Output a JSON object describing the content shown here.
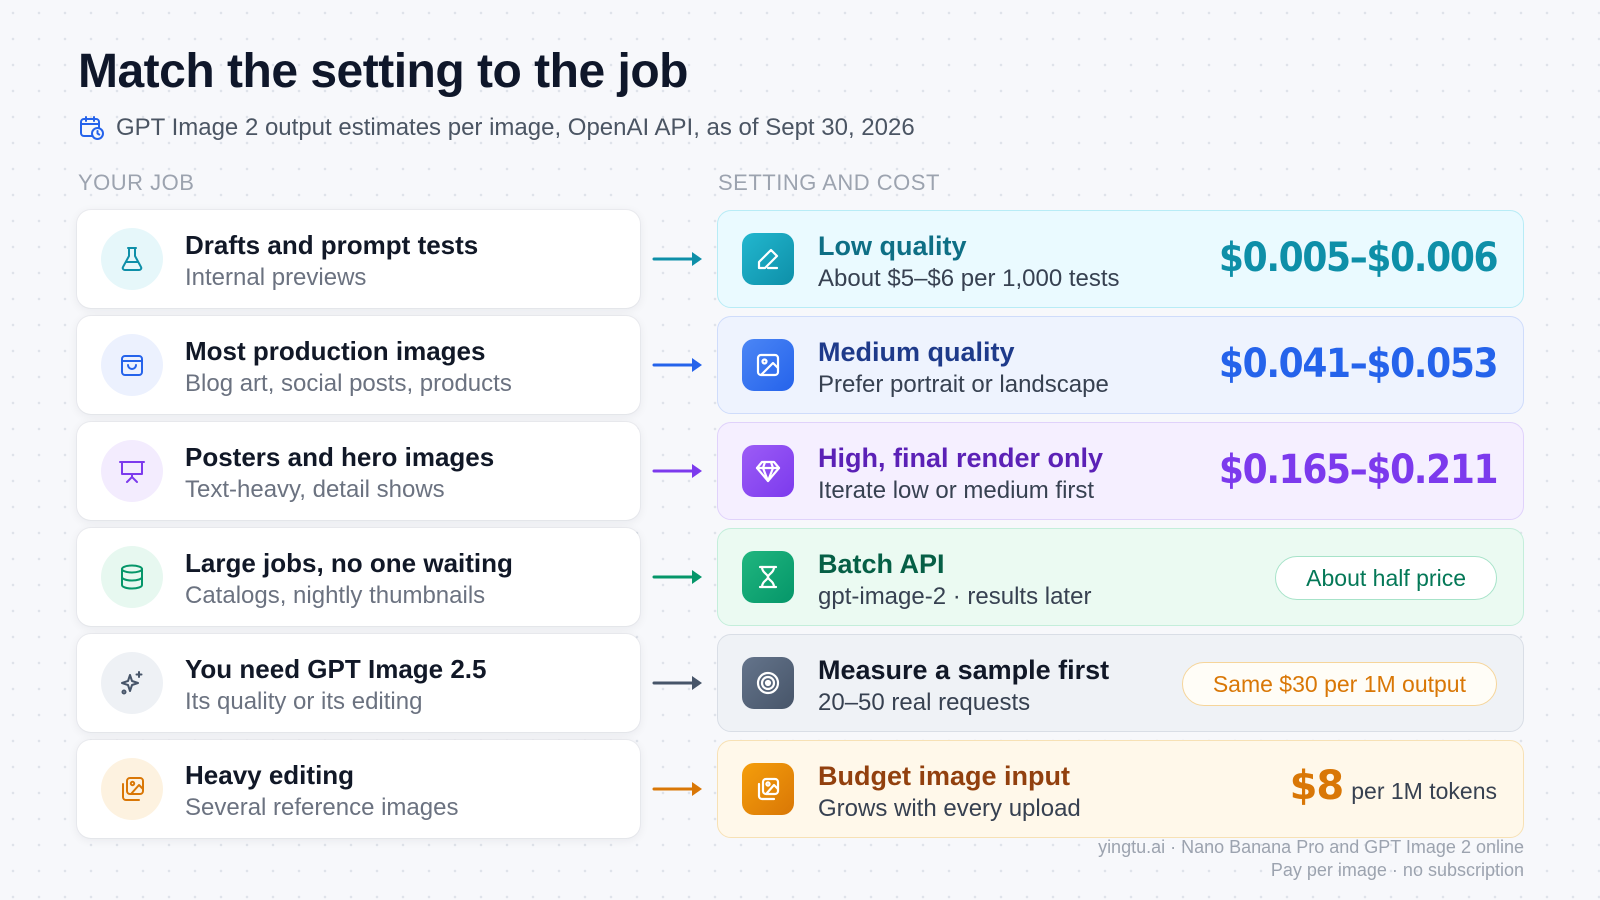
{
  "header": {
    "title": "Match the setting to the job",
    "subtitle": "GPT Image 2 output estimates per image, OpenAI API, as of Sept 30, 2026",
    "subtitle_icon": "calendar-clock-icon"
  },
  "columns": {
    "left": "YOUR JOB",
    "right": "SETTING AND COST"
  },
  "rows": [
    {
      "job_title": "Drafts and prompt tests",
      "job_sub": "Internal previews",
      "job_icon": "flask-icon",
      "setting_title": "Low quality",
      "setting_sub": "About $5–$6 per 1,000 tests",
      "setting_icon": "pencil-icon",
      "cost": "$0.005–$0.006",
      "accent": "#0e8fa8"
    },
    {
      "job_title": "Most production images",
      "job_sub": "Blog art, social posts, products",
      "job_icon": "shopping-bag-icon",
      "setting_title": "Medium quality",
      "setting_sub": "Prefer portrait or landscape",
      "setting_icon": "image-icon",
      "cost": "$0.041–$0.053",
      "accent": "#2563eb"
    },
    {
      "job_title": "Posters and hero images",
      "job_sub": "Text-heavy, detail shows",
      "job_icon": "presentation-board-icon",
      "setting_title": "High, final render only",
      "setting_sub": "Iterate low or medium first",
      "setting_icon": "gem-icon",
      "cost": "$0.165–$0.211",
      "accent": "#7c3aed"
    },
    {
      "job_title": "Large jobs, no one waiting",
      "job_sub": "Catalogs, nightly thumbnails",
      "job_icon": "database-icon",
      "setting_title": "Batch API",
      "setting_sub": "gpt-image-2 · results later",
      "setting_icon": "hourglass-icon",
      "cost": "About half price",
      "accent": "#059669"
    },
    {
      "job_title": "You need GPT Image 2.5",
      "job_sub": "Its quality or its editing",
      "job_icon": "sparkles-icon",
      "setting_title": "Measure a sample first",
      "setting_sub": "20–50 real requests",
      "setting_icon": "target-icon",
      "cost": "Same $30 per 1M output",
      "accent": "#475569"
    },
    {
      "job_title": "Heavy editing",
      "job_sub": "Several reference images",
      "job_icon": "image-stack-icon",
      "setting_title": "Budget image input",
      "setting_sub": "Grows with every upload",
      "setting_icon": "image-stack-icon",
      "cost": "$8",
      "cost_unit": "per 1M tokens",
      "accent": "#d97706"
    }
  ],
  "footer": {
    "line1": "yingtu.ai · Nano Banana Pro and GPT Image 2 online",
    "line2": "Pay per image · no subscription"
  }
}
